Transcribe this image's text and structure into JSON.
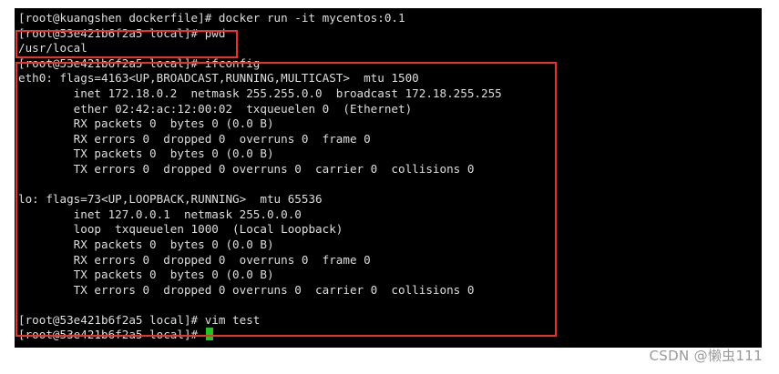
{
  "terminal": {
    "lines": [
      "[root@kuangshen dockerfile]# docker run -it mycentos:0.1",
      "[root@53e421b6f2a5 local]# pwd",
      "/usr/local",
      "[root@53e421b6f2a5 local]# ifconfig",
      "eth0: flags=4163<UP,BROADCAST,RUNNING,MULTICAST>  mtu 1500",
      "        inet 172.18.0.2  netmask 255.255.0.0  broadcast 172.18.255.255",
      "        ether 02:42:ac:12:00:02  txqueuelen 0  (Ethernet)",
      "        RX packets 0  bytes 0 (0.0 B)",
      "        RX errors 0  dropped 0  overruns 0  frame 0",
      "        TX packets 0  bytes 0 (0.0 B)",
      "        TX errors 0  dropped 0 overruns 0  carrier 0  collisions 0",
      "",
      "lo: flags=73<UP,LOOPBACK,RUNNING>  mtu 65536",
      "        inet 127.0.0.1  netmask 255.0.0.0",
      "        loop  txqueuelen 1000  (Local Loopback)",
      "        RX packets 0  bytes 0 (0.0 B)",
      "        RX errors 0  dropped 0  overruns 0  frame 0",
      "        TX packets 0  bytes 0 (0.0 B)",
      "        TX errors 0  dropped 0 overruns 0  carrier 0  collisions 0",
      "",
      "[root@53e421b6f2a5 local]# vim test",
      "[root@53e421b6f2a5 local]# "
    ]
  },
  "watermark": "CSDN @懒虫111",
  "colors": {
    "terminal_bg": "#000000",
    "terminal_text": "#dedede",
    "cursor": "#22c322",
    "highlight_border": "#e8322b",
    "watermark": "#9a9a9a"
  }
}
